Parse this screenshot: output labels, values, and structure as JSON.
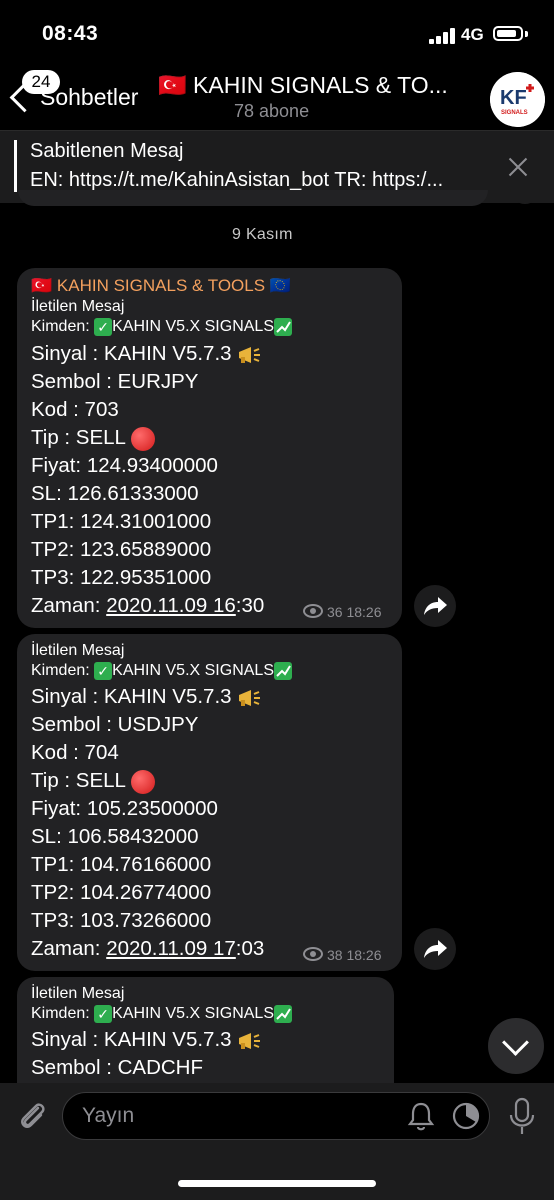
{
  "status_bar": {
    "time": "08:43",
    "network": "4G",
    "battery_level": 0.85
  },
  "header": {
    "unread_count": "24",
    "back_label": "Sohbetler",
    "channel_title": "🇹🇷 KAHIN SIGNALS & TO...",
    "subtitle": "78 abone",
    "avatar_text": "KF",
    "avatar_subtext": "SIGNALS"
  },
  "pinned": {
    "title": "Sabitlenen Mesaj",
    "text": "EN: https://t.me/KahinAsistan_bot TR: https:/..."
  },
  "date_label": "9 Kasım",
  "messages": [
    {
      "channel_header": "KAHIN SIGNALS & TOOLS",
      "forwarded_label": "İletilen Mesaj",
      "from_label": "Kimden:",
      "from_name": "KAHIN V5.X SIGNALS",
      "signal": "Sinyal : KAHIN V5.7.3",
      "symbol": "Sembol : EURJPY",
      "code": "Kod : 703",
      "type": "Tip : SELL",
      "price": "Fiyat: 124.93400000",
      "sl": "SL: 126.61333000",
      "tp1": "TP1: 124.31001000",
      "tp2": "TP2: 123.65889000",
      "tp3": "TP3: 122.95351000",
      "time_label": "Zaman: ",
      "time_link": "2020.11.09 16",
      "time_rest": ":30",
      "views": "36",
      "sent": "18:26"
    },
    {
      "forwarded_label": "İletilen Mesaj",
      "from_label": "Kimden:",
      "from_name": "KAHIN V5.X SIGNALS",
      "signal": "Sinyal : KAHIN V5.7.3",
      "symbol": "Sembol : USDJPY",
      "code": "Kod : 704",
      "type": "Tip : SELL",
      "price": "Fiyat: 105.23500000",
      "sl": "SL: 106.58432000",
      "tp1": "TP1: 104.76166000",
      "tp2": "TP2: 104.26774000",
      "tp3": "TP3: 103.73266000",
      "time_label": "Zaman: ",
      "time_link": "2020.11.09 17",
      "time_rest": ":03",
      "views": "38",
      "sent": "18:26"
    },
    {
      "forwarded_label": "İletilen Mesaj",
      "from_label": "Kimden:",
      "from_name": "KAHIN V5.X SIGNALS",
      "signal": "Sinyal : KAHIN V5.7.3",
      "symbol": "Sembol : CADCHF"
    }
  ],
  "input": {
    "placeholder": "Yayın"
  }
}
